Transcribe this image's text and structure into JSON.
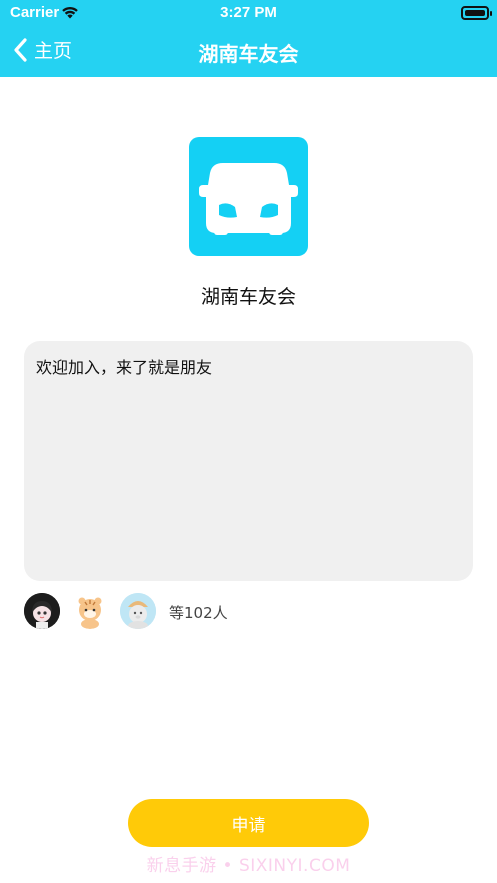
{
  "status_bar": {
    "carrier": "Carrier",
    "time": "3:27 PM"
  },
  "nav": {
    "back_label": "主页",
    "title": "湖南车友会"
  },
  "group": {
    "name": "湖南车友会",
    "icon": "car-icon",
    "icon_color": "#14D0F4"
  },
  "intro": {
    "text": "欢迎加入，来了就是朋友"
  },
  "members": {
    "avatars": [
      "avatar-girl",
      "avatar-tiger",
      "avatar-bear"
    ],
    "count_text": "等102人"
  },
  "actions": {
    "apply_label": "申请"
  },
  "watermark": {
    "text": "新息手游 • SIXINYI.COM"
  },
  "colors": {
    "header": "#25D2F2",
    "button": "#FFCA08",
    "intro_bg": "#F0F0F0"
  }
}
